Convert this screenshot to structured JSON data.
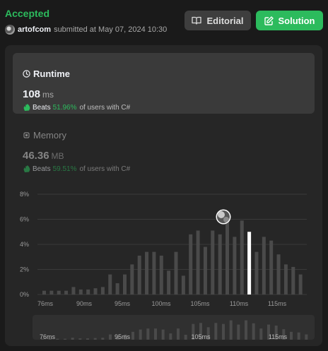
{
  "submission": {
    "status": "Accepted",
    "username": "artofcom",
    "submitted_text": "submitted at May 07, 2024 10:30"
  },
  "buttons": {
    "editorial_label": "Editorial",
    "solution_label": "Solution"
  },
  "runtime": {
    "title": "Runtime",
    "value": "108",
    "unit": "ms",
    "beats_label": "Beats",
    "beats_percent": "51.96%",
    "beats_suffix": "of users with C#"
  },
  "memory": {
    "title": "Memory",
    "value": "46.36",
    "unit": "MB",
    "beats_label": "Beats",
    "beats_percent": "59.51%",
    "beats_suffix": "of users with C#"
  },
  "colors": {
    "accent": "#2cbb5d",
    "bar": "#4a4a4a",
    "highlight_bar": "#ffffff"
  },
  "icons": {
    "editorial": "book-icon",
    "solution": "edit-icon",
    "runtime": "clock-icon",
    "memory": "chip-icon",
    "beats": "hand-clap-icon"
  },
  "chart_data": {
    "type": "bar",
    "xlabel": "",
    "ylabel": "",
    "ylim": [
      0,
      8
    ],
    "yticks": [
      "0%",
      "2%",
      "4%",
      "6%",
      "8%"
    ],
    "xticks": [
      "76ms",
      "90ms",
      "95ms",
      "100ms",
      "105ms",
      "110ms",
      "115ms"
    ],
    "grid": true,
    "highlight_index": 28,
    "values": [
      0.3,
      0.3,
      0.3,
      0.3,
      0.6,
      0.4,
      0.4,
      0.5,
      0.6,
      1.6,
      0.9,
      1.6,
      2.4,
      3.1,
      3.4,
      3.4,
      3.1,
      1.9,
      3.4,
      1.5,
      4.8,
      5.1,
      3.8,
      5.1,
      4.8,
      5.9,
      4.6,
      5.9,
      5.0,
      3.4,
      4.6,
      4.3,
      3.2,
      2.4,
      2.2,
      1.6
    ],
    "overview_values": [
      0.3,
      0.3,
      0.3,
      0.3,
      0.6,
      0.4,
      0.4,
      0.5,
      0.6,
      1.6,
      0.9,
      1.6,
      2.4,
      3.1,
      3.4,
      3.4,
      3.1,
      1.9,
      3.4,
      1.5,
      4.8,
      5.1,
      3.8,
      5.1,
      4.8,
      5.9,
      4.6,
      5.9,
      5.0,
      3.4,
      4.6,
      4.3,
      3.2,
      2.4,
      2.2,
      1.6
    ],
    "overview_xticks": [
      "76ms",
      "95ms",
      "105ms",
      "115ms"
    ]
  }
}
